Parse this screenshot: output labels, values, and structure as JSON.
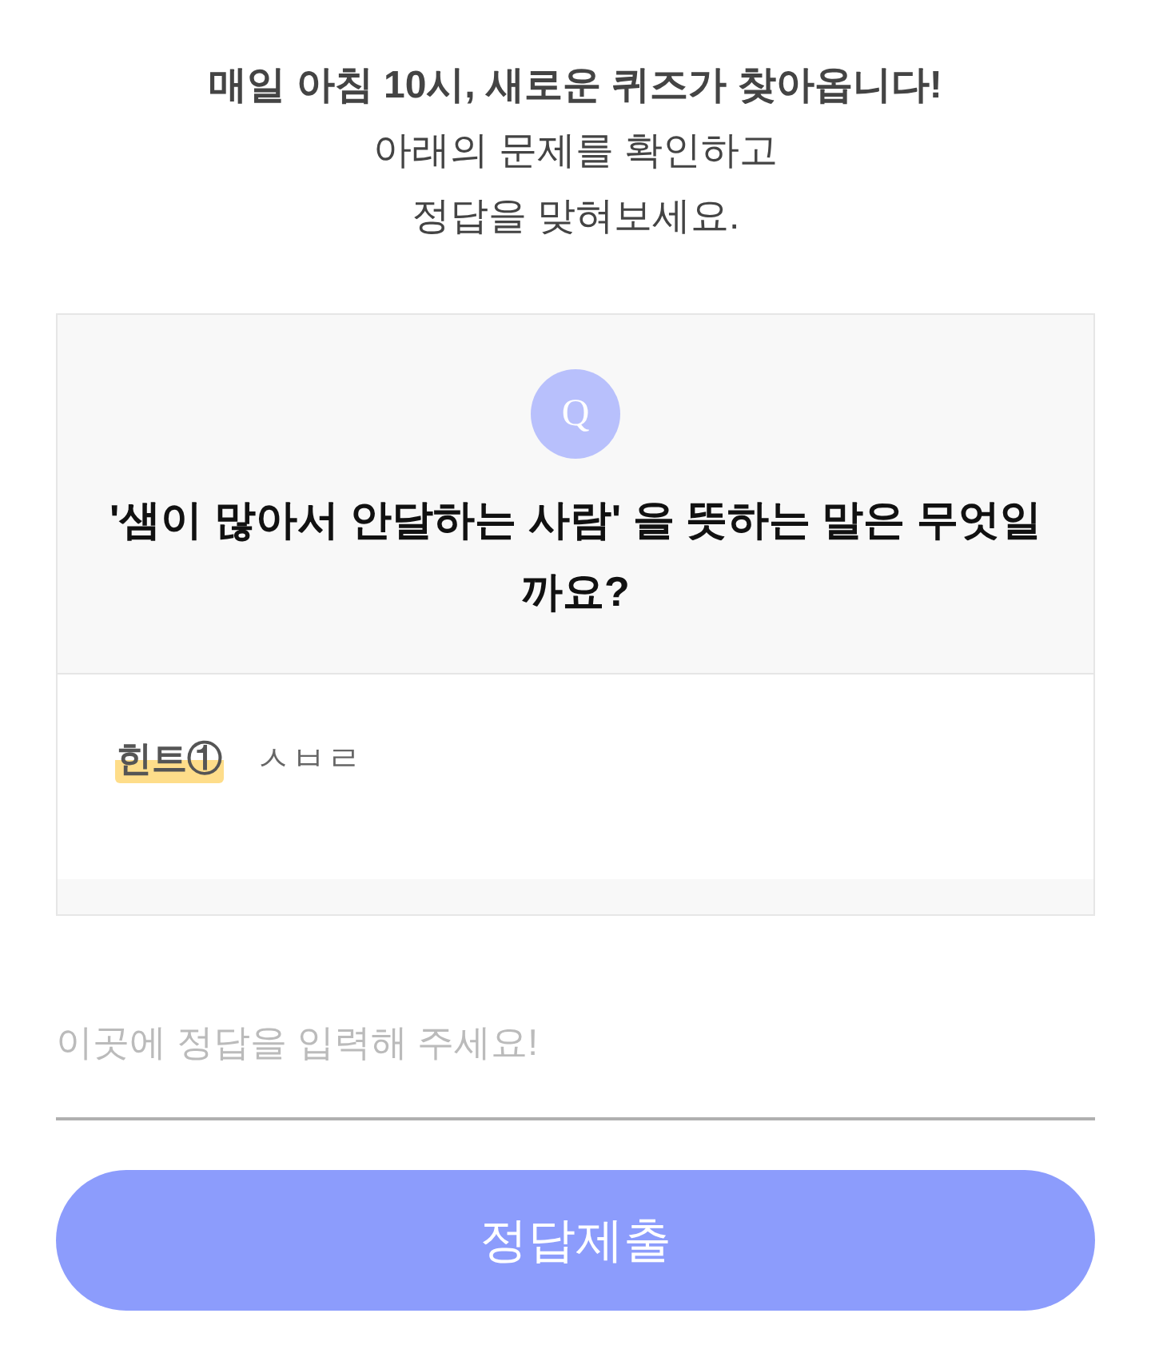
{
  "intro": {
    "headline": "매일 아침 10시, 새로운 퀴즈가 찾아옵니다!",
    "lines": [
      "아래의 문제를 확인하고",
      "정답을 맞혀보세요."
    ]
  },
  "quiz_card": {
    "badge": "Q",
    "question": "'샘이 많아서 안달하는 사람' 을 뜻하는 말은 무엇일까요?",
    "hints": [
      {
        "label": "힌트①",
        "text": "ㅅㅂㄹ"
      }
    ]
  },
  "answer_field": {
    "placeholder": "이곳에 정답을 입력해 주세요!"
  },
  "submit_button": {
    "label": "정답제출"
  }
}
